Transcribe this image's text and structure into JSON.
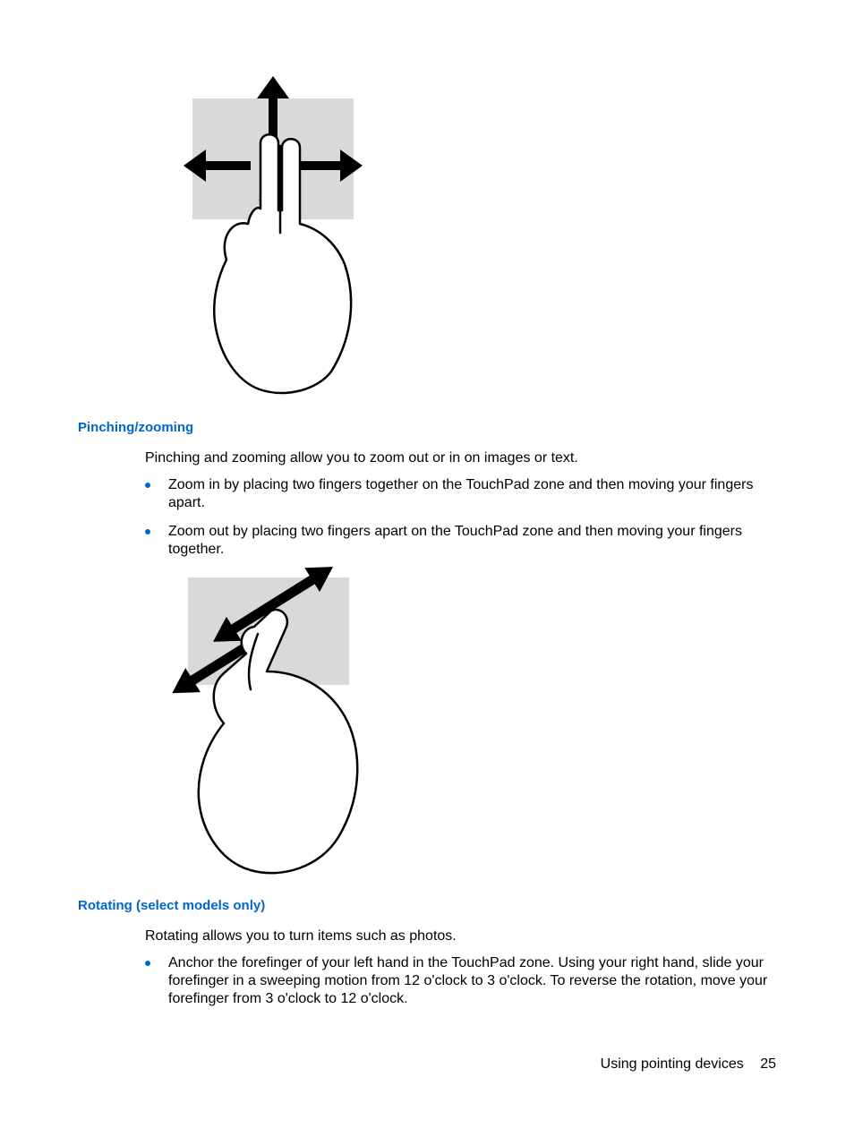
{
  "sections": {
    "pinching": {
      "heading": "Pinching/zooming",
      "intro": "Pinching and zooming allow you to zoom out or in on images or text.",
      "bullets": [
        "Zoom in by placing two fingers together on the TouchPad zone and then moving your fingers apart.",
        "Zoom out by placing two fingers apart on the TouchPad zone and then moving your fingers together."
      ]
    },
    "rotating": {
      "heading": "Rotating (select models only)",
      "intro": "Rotating allows you to turn items such as photos.",
      "bullets": [
        "Anchor the forefinger of your left hand in the TouchPad zone. Using your right hand, slide your forefinger in a sweeping motion from 12 o'clock to 3 o'clock. To reverse the rotation, move your forefinger from 3 o'clock to 12 o'clock."
      ]
    }
  },
  "footer": {
    "section_title": "Using pointing devices",
    "page_number": "25"
  },
  "figures": {
    "scroll": "Two-finger scroll gesture illustration: a hand with index and middle fingers on a touchpad, with arrows pointing up, down, left, and right.",
    "pinch": "Pinch/zoom gesture illustration: a hand with thumb and index finger on a touchpad, with two pairs of arrows indicating fingers moving together and apart diagonally."
  }
}
